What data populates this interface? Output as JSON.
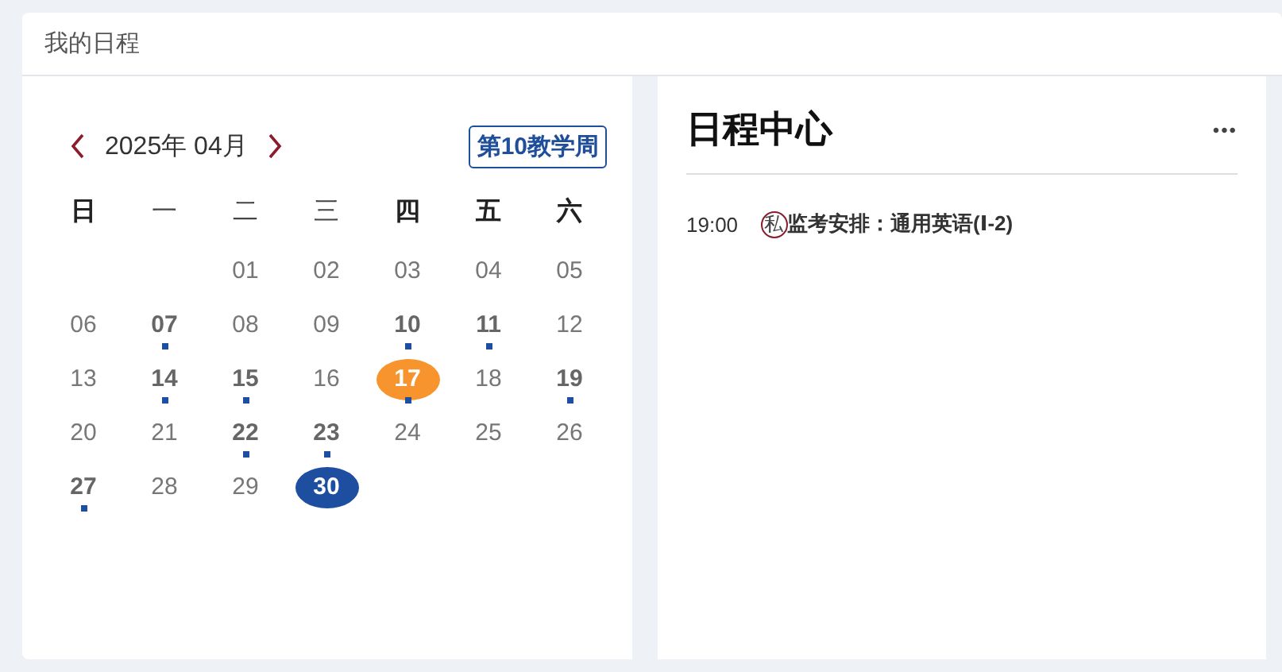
{
  "card_title": "我的日程",
  "calendar": {
    "month_label": "2025年 04月",
    "week_badge": "第10教学周",
    "weekdays": [
      {
        "label": "日",
        "bold": true
      },
      {
        "label": "一",
        "bold": false
      },
      {
        "label": "二",
        "bold": false
      },
      {
        "label": "三",
        "bold": false
      },
      {
        "label": "四",
        "bold": true
      },
      {
        "label": "五",
        "bold": true
      },
      {
        "label": "六",
        "bold": true
      }
    ],
    "weeks": [
      [
        {
          "day": "01",
          "has_event": false,
          "today": false,
          "selected": false
        },
        {
          "day": "02",
          "has_event": false,
          "today": false,
          "selected": false
        },
        {
          "day": "03",
          "has_event": false,
          "today": false,
          "selected": false
        },
        {
          "day": "04",
          "has_event": false,
          "today": false,
          "selected": false
        },
        {
          "day": "05",
          "has_event": false,
          "today": false,
          "selected": false
        }
      ],
      [
        {
          "day": "06",
          "has_event": false,
          "today": false,
          "selected": false
        },
        {
          "day": "07",
          "has_event": true,
          "today": false,
          "selected": false
        },
        {
          "day": "08",
          "has_event": false,
          "today": false,
          "selected": false
        },
        {
          "day": "09",
          "has_event": false,
          "today": false,
          "selected": false
        },
        {
          "day": "10",
          "has_event": true,
          "today": false,
          "selected": false
        },
        {
          "day": "11",
          "has_event": true,
          "today": false,
          "selected": false
        },
        {
          "day": "12",
          "has_event": false,
          "today": false,
          "selected": false
        }
      ],
      [
        {
          "day": "13",
          "has_event": false,
          "today": false,
          "selected": false
        },
        {
          "day": "14",
          "has_event": true,
          "today": false,
          "selected": false
        },
        {
          "day": "15",
          "has_event": true,
          "today": false,
          "selected": false
        },
        {
          "day": "16",
          "has_event": false,
          "today": false,
          "selected": false
        },
        {
          "day": "17",
          "has_event": true,
          "today": true,
          "selected": false
        },
        {
          "day": "18",
          "has_event": false,
          "today": false,
          "selected": false
        },
        {
          "day": "19",
          "has_event": true,
          "today": false,
          "selected": false
        }
      ],
      [
        {
          "day": "20",
          "has_event": false,
          "today": false,
          "selected": false
        },
        {
          "day": "21",
          "has_event": false,
          "today": false,
          "selected": false
        },
        {
          "day": "22",
          "has_event": true,
          "today": false,
          "selected": false
        },
        {
          "day": "23",
          "has_event": true,
          "today": false,
          "selected": false
        },
        {
          "day": "24",
          "has_event": false,
          "today": false,
          "selected": false
        },
        {
          "day": "25",
          "has_event": false,
          "today": false,
          "selected": false
        },
        {
          "day": "26",
          "has_event": false,
          "today": false,
          "selected": false
        }
      ],
      [
        {
          "day": "27",
          "has_event": true,
          "today": false,
          "selected": false
        },
        {
          "day": "28",
          "has_event": false,
          "today": false,
          "selected": false
        },
        {
          "day": "29",
          "has_event": false,
          "today": false,
          "selected": false
        },
        {
          "day": "30",
          "has_event": false,
          "today": false,
          "selected": true
        }
      ]
    ]
  },
  "schedule": {
    "title": "日程中心",
    "more": "•••",
    "events": [
      {
        "time": "19:00",
        "tag": "私",
        "title": "监考安排：通用英语(Ⅰ-2)"
      }
    ]
  }
}
